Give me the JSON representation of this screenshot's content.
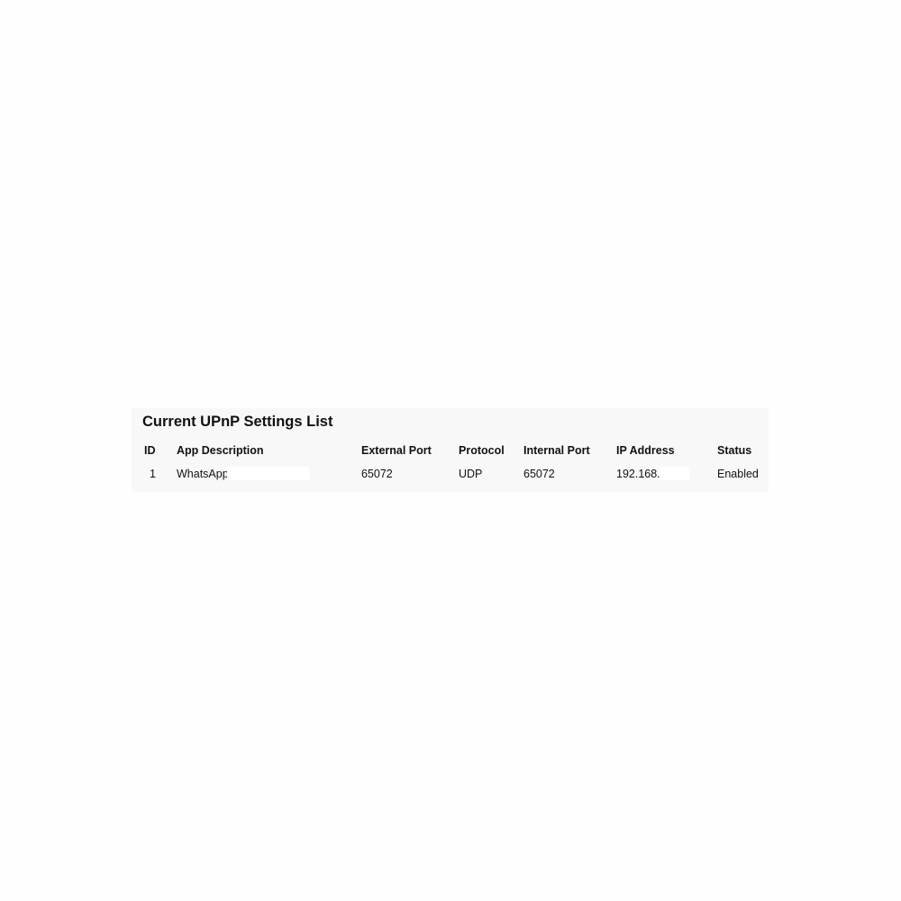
{
  "panel": {
    "title": "Current UPnP Settings List"
  },
  "table": {
    "columns": [
      "ID",
      "App Description",
      "External Port",
      "Protocol",
      "Internal Port",
      "IP Address",
      "Status"
    ],
    "rows": [
      {
        "id": "1",
        "app_description": "WhatsApp",
        "external_port": "65072",
        "protocol": "UDP",
        "internal_port": "65072",
        "ip_address": "192.168.",
        "status": "Enabled"
      }
    ]
  }
}
